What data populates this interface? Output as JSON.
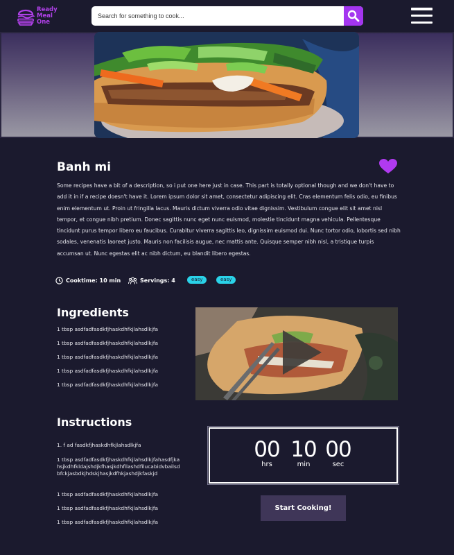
{
  "header": {
    "logo_text": "Ready\nMeal\nOne",
    "search_placeholder": "Search for something to cook...",
    "search_icon": "search-icon",
    "menu_icon": "hamburger-menu-icon"
  },
  "recipe": {
    "title": "Banh mi",
    "description": "Some recipes have a bit of a description, so i put one here just in case. This part is totally optional though and we don't have to add it in if a recipe doesn't have it. Lorem ipsum dolor sit amet, consectetur adipiscing elit. Cras elementum felis odio, eu finibus enim elementum ut. Proin ut fringilla lacus. Mauris dictum viverra odio vitae dignissim. Vestibulum congue elit sit amet nisl tempor, et congue nibh pretium. Donec sagittis nunc eget nunc euismod, molestie tincidunt magna vehicula. Pellentesque tincidunt purus tempor libero eu faucibus. Curabitur viverra sagittis leo, dignissim euismod dui. Nunc tortor odio, lobortis sed nibh sodales, venenatis laoreet justo. Mauris non facilisis augue, nec mattis ante. Quisque semper nibh nisl, a tristique turpis accumsan ut. Nunc egestas elit ac nibh dictum, eu blandit libero egestas.",
    "cooktime": "Cooktime: 10 min",
    "servings": "Servings: 4",
    "tags": [
      "easy",
      "easy"
    ],
    "favorite_icon": "heart-icon",
    "accent_color": "#a435f0",
    "tag_color": "#2ad2e8"
  },
  "ingredients": {
    "heading": "Ingredients",
    "items": [
      "1 tbsp asdfadfasdkfjhaskdhfkjlahsdlkjfa",
      "1 tbsp asdfadfasdkfjhaskdhfkjlahsdlkjfa",
      "1 tbsp asdfadfasdkfjhaskdhfkjlahsdlkjfa",
      "1 tbsp asdfadfasdkfjhaskdhfkjlahsdlkjfa",
      "1 tbsp asdfadfasdkfjhaskdhfkjlahsdlkjfa"
    ]
  },
  "instructions": {
    "heading": "Instructions",
    "items": [
      "1.  f ad fasdkfjhaskdhfkjlahsdlkjfa",
      "1 tbsp asdfadfasdkfjhaskdhfkjlahsdlkjfahasdfjkahsjkdhfkldajshdjkfhasjkdhfilashdfilucabidvbailsdbfckjasbdkjhdskjhasjkdfhkjashdjkfaskjd",
      "1 tbsp asdfadfasdkfjhaskdhfkjlahsdlkjfa",
      "1 tbsp asdfadfasdkfjhaskdhfkjlahsdlkjfa",
      "1 tbsp asdfadfasdkfjhaskdhfkjlahsdlkjfa"
    ]
  },
  "timer": {
    "hours": "00",
    "hours_label": "hrs",
    "minutes": "10",
    "minutes_label": "min",
    "seconds": "00",
    "seconds_label": "sec"
  },
  "actions": {
    "start_label": "Start Cooking!"
  }
}
